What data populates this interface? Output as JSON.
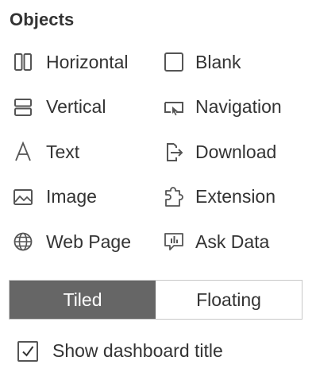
{
  "panel": {
    "title": "Objects"
  },
  "objects": [
    {
      "label": "Horizontal",
      "icon": "horizontal-layout-icon"
    },
    {
      "label": "Blank",
      "icon": "blank-icon"
    },
    {
      "label": "Vertical",
      "icon": "vertical-layout-icon"
    },
    {
      "label": "Navigation",
      "icon": "navigation-icon"
    },
    {
      "label": "Text",
      "icon": "text-icon"
    },
    {
      "label": "Download",
      "icon": "download-icon"
    },
    {
      "label": "Image",
      "icon": "image-icon"
    },
    {
      "label": "Extension",
      "icon": "extension-icon"
    },
    {
      "label": "Web Page",
      "icon": "globe-icon"
    },
    {
      "label": "Ask Data",
      "icon": "ask-data-icon"
    }
  ],
  "layout_mode": {
    "options": [
      "Tiled",
      "Floating"
    ],
    "selected": "Tiled"
  },
  "show_title": {
    "label": "Show dashboard title",
    "checked": true
  },
  "colors": {
    "active_segment": "#666666",
    "text": "#333333",
    "border": "#c8c8c8"
  }
}
